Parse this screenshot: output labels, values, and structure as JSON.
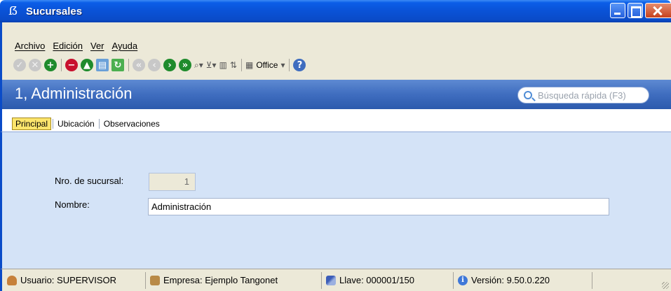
{
  "window": {
    "title": "Sucursales"
  },
  "menu": {
    "items": [
      "Archivo",
      "Edición",
      "Ver",
      "Ayuda"
    ]
  },
  "toolbar": {
    "icons": [
      "accept-icon",
      "cancel-icon",
      "add-icon",
      "delete-icon",
      "enable-icon",
      "export-icon",
      "refresh-icon",
      "first-record-icon",
      "previous-record-icon",
      "next-record-icon",
      "last-record-icon",
      "find-icon",
      "filter-icon",
      "columns-icon",
      "sort-icon",
      "office-icon",
      "help-icon"
    ],
    "office_label": "Office"
  },
  "header": {
    "title": "1, Administración",
    "search_placeholder": "Búsqueda rápida (F3)"
  },
  "tabs": [
    {
      "label": "Principal",
      "active": true
    },
    {
      "label": "Ubicación",
      "active": false
    },
    {
      "label": "Observaciones",
      "active": false
    }
  ],
  "form": {
    "nro_label": "Nro. de sucursal:",
    "nro_value": "1",
    "nombre_label": "Nombre:",
    "nombre_value": "Administración"
  },
  "status": {
    "user": "Usuario: SUPERVISOR",
    "company": "Empresa: Ejemplo Tangonet",
    "key": "Llave: 000001/150",
    "version": "Versión: 9.50.0.220"
  },
  "colors": {
    "titlebar": "#0a52d6",
    "header": "#3f6dbf",
    "content_bg": "#d4e3f7",
    "active_tab": "#fde56c"
  }
}
